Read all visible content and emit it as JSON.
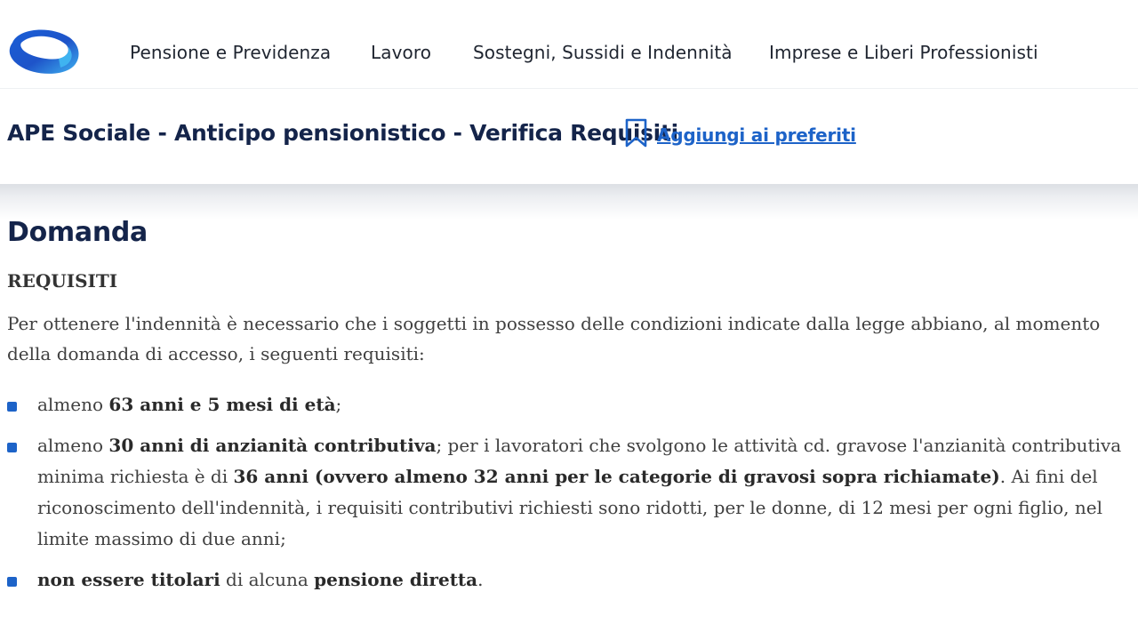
{
  "nav": {
    "logo_icon": "inps-logo-icon",
    "items": [
      {
        "label": "Pensione e Previdenza"
      },
      {
        "label": "Lavoro"
      },
      {
        "label": "Sostegni, Sussidi e Indennità"
      },
      {
        "label": "Imprese e Liberi Professionisti"
      }
    ]
  },
  "header": {
    "title": "APE Sociale - Anticipo pensionistico - Verifica Requisiti",
    "bookmark_icon": "bookmark-icon",
    "favorite_link": "Aggiungi ai preferiti"
  },
  "content": {
    "section_title": "Domanda",
    "requirements_heading": "REQUISITI",
    "intro": "Per ottenere l'indennità è necessario che i soggetti in possesso delle condizioni indicate dalla legge abbiano, al momento della domanda di accesso, i seguenti requisiti:",
    "bullets": [
      {
        "t1": "almeno ",
        "b1": "63 anni e 5 mesi di età",
        "t2": ";"
      },
      {
        "t1": "almeno ",
        "b1": "30 anni di anzianità contributiva",
        "t2": "; per i lavoratori che svolgono le attività cd. gravose l'anzianità contributiva minima richiesta è di ",
        "b2": "36 anni (ovvero almeno 32 anni per le categorie di gravosi sopra richiamate)",
        "t3": ". Ai fini del riconoscimento dell'indennità, i requisiti contributivi richiesti sono ridotti, per le donne, di 12 mesi per ogni figlio, nel limite massimo di due anni;"
      },
      {
        "b1": "non essere titolari",
        "t1": " di alcuna ",
        "b2": "pensione diretta",
        "t2": "."
      }
    ]
  },
  "colors": {
    "brand_blue": "#1d63c8",
    "title_navy": "#14244a",
    "logo_light": "#3fb3f0"
  }
}
